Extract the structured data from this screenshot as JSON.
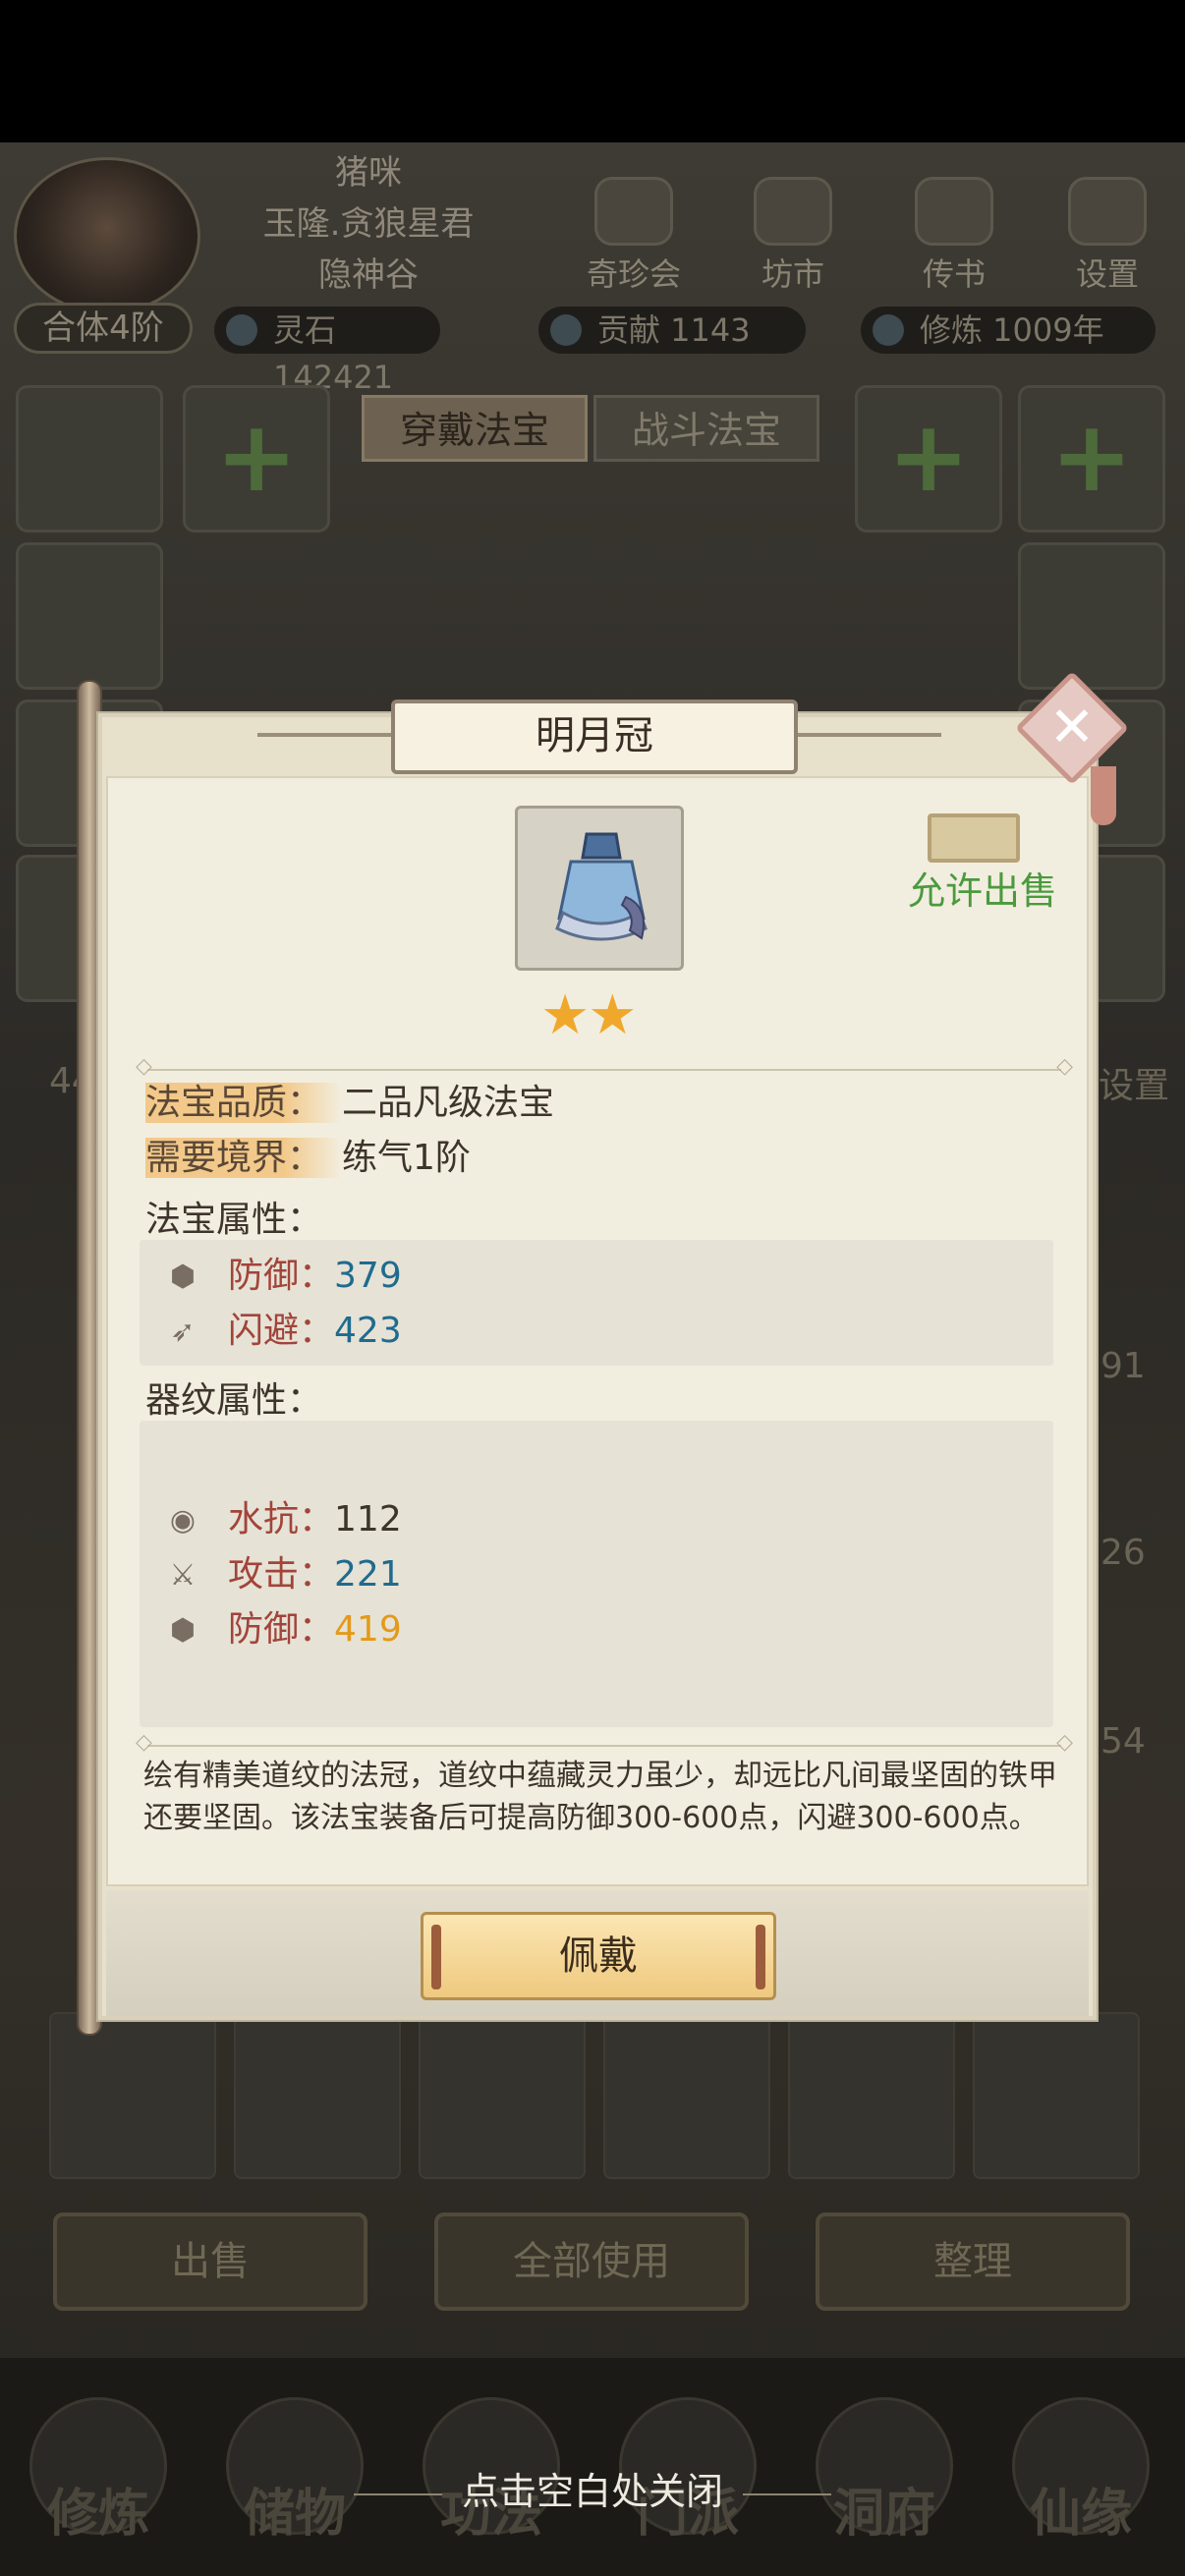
{
  "player": {
    "name": "猪咪",
    "title": "玉隆.贪狼星君",
    "sect": "隐神谷",
    "rank": "合体4阶"
  },
  "resources": {
    "spirit_stone": "灵石 142421",
    "contribution": "贡献 1143",
    "cultivation": "修炼 1009年"
  },
  "top_menu": [
    "奇珍会",
    "坊市",
    "传书",
    "设置"
  ],
  "equip_tabs": {
    "active": "穿戴法宝",
    "inactive": "战斗法宝"
  },
  "background_labels": {
    "left_number": "44",
    "right_text": "设置",
    "side_numbers": [
      "91",
      "26",
      "54"
    ]
  },
  "bottom_buttons": [
    "出售",
    "全部使用",
    "整理"
  ],
  "bottom_nav": [
    "修炼",
    "储物",
    "功法",
    "门派",
    "洞府",
    "仙缘"
  ],
  "close_hint": "点击空白处关闭",
  "item": {
    "name": "明月冠",
    "sell_status": "允许出售",
    "stars": 2,
    "quality_label": "法宝品质：",
    "quality_value": "二品凡级法宝",
    "realm_label": "需要境界：",
    "realm_value": "练气1阶",
    "base_attr_title": "法宝属性：",
    "base_attrs": [
      {
        "icon": "defense-icon",
        "name": "防御",
        "value": "379",
        "color": "#1f6b8e"
      },
      {
        "icon": "dodge-icon",
        "name": "闪避",
        "value": "423",
        "color": "#1f6b8e"
      }
    ],
    "rune_attr_title": "器纹属性：",
    "rune_attrs": [
      {
        "icon": "water-resist-icon",
        "name": "水抗",
        "value": "112",
        "color": "#3d342c"
      },
      {
        "icon": "attack-icon",
        "name": "攻击",
        "value": "221",
        "color": "#1f6b8e"
      },
      {
        "icon": "defense-icon",
        "name": "防御",
        "value": "419",
        "color": "#e39a1a"
      }
    ],
    "description": "绘有精美道纹的法冠，道纹中蕴藏灵力虽少，却远比凡间最坚固的铁甲还要坚固。该法宝装备后可提高防御300-600点，闪避300-600点。",
    "equip_button": "佩戴"
  }
}
